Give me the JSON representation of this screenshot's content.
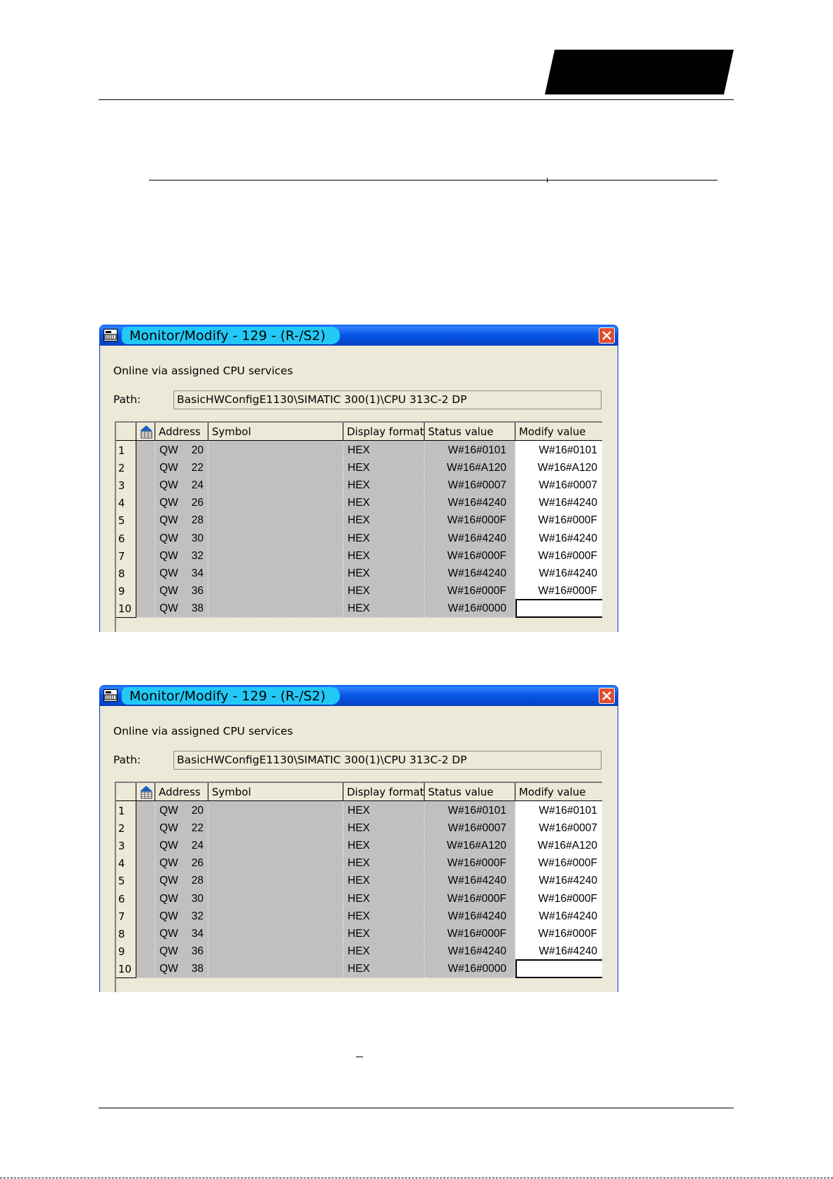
{
  "dialogs": [
    {
      "title": "Monitor/Modify - 129 - (R-/S2)",
      "online_text": "Online via assigned CPU services",
      "path_label": "Path:",
      "path_value": "BasicHWConfigE1130\\SIMATIC 300(1)\\CPU 313C-2 DP",
      "columns": [
        "Address",
        "Symbol",
        "Display format",
        "Status value",
        "Modify value"
      ],
      "rows": [
        {
          "n": "1",
          "op": "QW",
          "addr": "20",
          "symbol": "",
          "format": "HEX",
          "status": "W#16#0101",
          "modify": "W#16#0101"
        },
        {
          "n": "2",
          "op": "QW",
          "addr": "22",
          "symbol": "",
          "format": "HEX",
          "status": "W#16#A120",
          "modify": "W#16#A120"
        },
        {
          "n": "3",
          "op": "QW",
          "addr": "24",
          "symbol": "",
          "format": "HEX",
          "status": "W#16#0007",
          "modify": "W#16#0007"
        },
        {
          "n": "4",
          "op": "QW",
          "addr": "26",
          "symbol": "",
          "format": "HEX",
          "status": "W#16#4240",
          "modify": "W#16#4240"
        },
        {
          "n": "5",
          "op": "QW",
          "addr": "28",
          "symbol": "",
          "format": "HEX",
          "status": "W#16#000F",
          "modify": "W#16#000F"
        },
        {
          "n": "6",
          "op": "QW",
          "addr": "30",
          "symbol": "",
          "format": "HEX",
          "status": "W#16#4240",
          "modify": "W#16#4240"
        },
        {
          "n": "7",
          "op": "QW",
          "addr": "32",
          "symbol": "",
          "format": "HEX",
          "status": "W#16#000F",
          "modify": "W#16#000F"
        },
        {
          "n": "8",
          "op": "QW",
          "addr": "34",
          "symbol": "",
          "format": "HEX",
          "status": "W#16#4240",
          "modify": "W#16#4240"
        },
        {
          "n": "9",
          "op": "QW",
          "addr": "36",
          "symbol": "",
          "format": "HEX",
          "status": "W#16#000F",
          "modify": "W#16#000F"
        },
        {
          "n": "10",
          "op": "QW",
          "addr": "38",
          "symbol": "",
          "format": "HEX",
          "status": "W#16#0000",
          "modify": ""
        }
      ]
    },
    {
      "title": "Monitor/Modify - 129 - (R-/S2)",
      "online_text": "Online via assigned CPU services",
      "path_label": "Path:",
      "path_value": "BasicHWConfigE1130\\SIMATIC 300(1)\\CPU 313C-2 DP",
      "columns": [
        "Address",
        "Symbol",
        "Display format",
        "Status value",
        "Modify value"
      ],
      "rows": [
        {
          "n": "1",
          "op": "QW",
          "addr": "20",
          "symbol": "",
          "format": "HEX",
          "status": "W#16#0101",
          "modify": "W#16#0101"
        },
        {
          "n": "2",
          "op": "QW",
          "addr": "22",
          "symbol": "",
          "format": "HEX",
          "status": "W#16#0007",
          "modify": "W#16#0007"
        },
        {
          "n": "3",
          "op": "QW",
          "addr": "24",
          "symbol": "",
          "format": "HEX",
          "status": "W#16#A120",
          "modify": "W#16#A120"
        },
        {
          "n": "4",
          "op": "QW",
          "addr": "26",
          "symbol": "",
          "format": "HEX",
          "status": "W#16#000F",
          "modify": "W#16#000F"
        },
        {
          "n": "5",
          "op": "QW",
          "addr": "28",
          "symbol": "",
          "format": "HEX",
          "status": "W#16#4240",
          "modify": "W#16#4240"
        },
        {
          "n": "6",
          "op": "QW",
          "addr": "30",
          "symbol": "",
          "format": "HEX",
          "status": "W#16#000F",
          "modify": "W#16#000F"
        },
        {
          "n": "7",
          "op": "QW",
          "addr": "32",
          "symbol": "",
          "format": "HEX",
          "status": "W#16#4240",
          "modify": "W#16#4240"
        },
        {
          "n": "8",
          "op": "QW",
          "addr": "34",
          "symbol": "",
          "format": "HEX",
          "status": "W#16#000F",
          "modify": "W#16#000F"
        },
        {
          "n": "9",
          "op": "QW",
          "addr": "36",
          "symbol": "",
          "format": "HEX",
          "status": "W#16#4240",
          "modify": "W#16#4240"
        },
        {
          "n": "10",
          "op": "QW",
          "addr": "38",
          "symbol": "",
          "format": "HEX",
          "status": "W#16#0000",
          "modify": ""
        }
      ]
    }
  ],
  "icons": {
    "app": "simatic-app-icon",
    "close": "close-icon",
    "table_corner": "monitor-table-icon",
    "header_badge": "header-badge"
  },
  "colors": {
    "title_pill": "#23c9f6",
    "titlebar": "#0a59e6",
    "close": "#e14b2e",
    "dialog_bg": "#ece9d8",
    "cell_bg": "#c0c0c0"
  }
}
